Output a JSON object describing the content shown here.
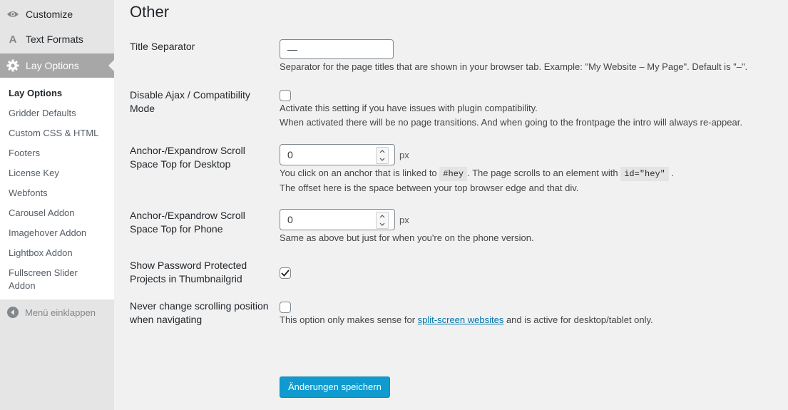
{
  "sidebar": {
    "top_items": [
      {
        "label": "Customize",
        "icon": "eye-icon"
      },
      {
        "label": "Text Formats",
        "icon": "letter-a-icon"
      },
      {
        "label": "Lay Options",
        "icon": "gear-icon"
      }
    ],
    "submenu": [
      "Lay Options",
      "Gridder Defaults",
      "Custom CSS & HTML",
      "Footers",
      "License Key",
      "Webfonts",
      "Carousel Addon",
      "Imagehover Addon",
      "Lightbox Addon",
      "Fullscreen Slider Addon"
    ],
    "collapse_label": "Menü einklappen"
  },
  "page": {
    "title": "Other"
  },
  "settings": {
    "title_separator": {
      "label": "Title Separator",
      "value": "—",
      "desc": "Separator for the page titles that are shown in your browser tab. Example: \"My Website – My Page\". Default is \"–\"."
    },
    "disable_ajax": {
      "label": "Disable Ajax / Compatibility Mode",
      "checked": false,
      "desc1": "Activate this setting if you have issues with plugin compatibility.",
      "desc2": "When activated there will be no page transitions. And when going to the frontpage the intro will always re-appear."
    },
    "anchor_desktop": {
      "label": "Anchor-/Expandrow Scroll Space Top for Desktop",
      "value": "0",
      "unit": "px",
      "desc_a": "You click on an anchor that is linked to",
      "code1": "#hey",
      "desc_b": ". The page scrolls to an element with",
      "code2": "id=\"hey\"",
      "desc_c": ".",
      "desc2": "The offset here is the space between your top browser edge and that div."
    },
    "anchor_phone": {
      "label": "Anchor-/Expandrow Scroll Space Top for Phone",
      "value": "0",
      "unit": "px",
      "desc": "Same as above but just for when you're on the phone version."
    },
    "show_password": {
      "label": "Show Password Protected Projects in Thumbnailgrid",
      "checked": true
    },
    "never_change_scroll": {
      "label": "Never change scrolling position when navigating",
      "checked": false,
      "desc_a": "This option only makes sense for",
      "link": "split-screen websites",
      "desc_b": "and is active for desktop/tablet only."
    }
  },
  "save_button": "Änderungen speichern",
  "colors": {
    "accent": "#0f9bcf",
    "sidebar_active": "#a7a7a7",
    "link": "#0073aa"
  }
}
